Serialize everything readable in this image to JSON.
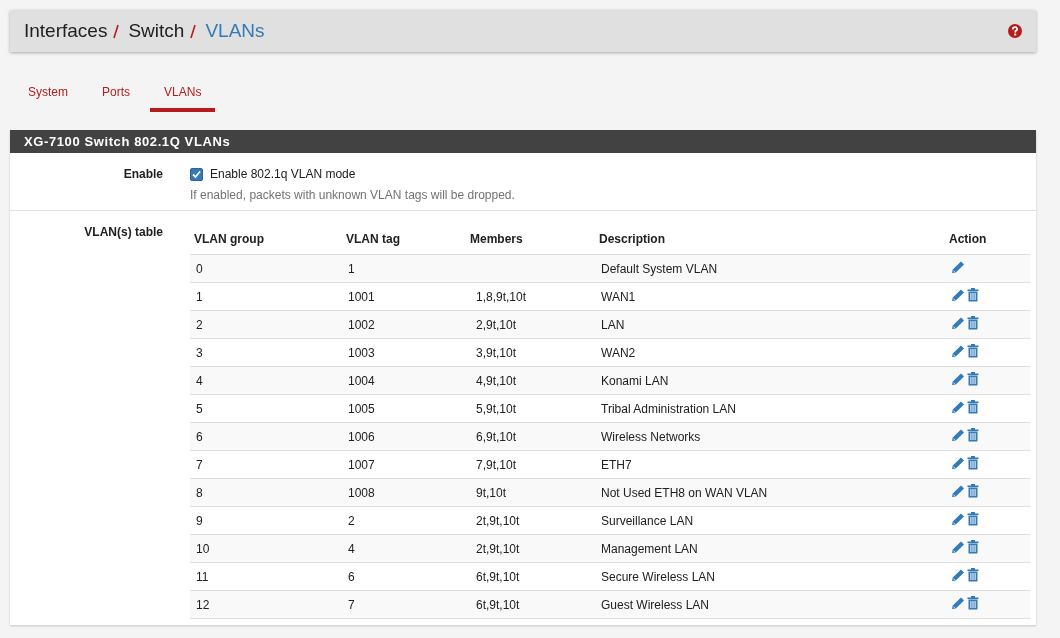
{
  "breadcrumb": [
    "Interfaces",
    "Switch",
    "VLANs"
  ],
  "tabs": [
    {
      "label": "System",
      "selected": false
    },
    {
      "label": "Ports",
      "selected": false
    },
    {
      "label": "VLANs",
      "selected": true
    }
  ],
  "panel": {
    "title": "XG-7100 Switch 802.1Q VLANs",
    "enable": {
      "label": "Enable",
      "checkbox_label": "Enable 802.1q VLAN mode",
      "checked": true,
      "help": "If enabled, packets with unknown VLAN tags will be dropped."
    },
    "table_label": "VLAN(s) table",
    "columns": [
      "VLAN group",
      "VLAN tag",
      "Members",
      "Description",
      "Action"
    ],
    "rows": [
      {
        "group": "0",
        "tag": "1",
        "members": "",
        "description": "Default System VLAN",
        "deletable": false
      },
      {
        "group": "1",
        "tag": "1001",
        "members": "1,8,9t,10t",
        "description": "WAN1",
        "deletable": true
      },
      {
        "group": "2",
        "tag": "1002",
        "members": "2,9t,10t",
        "description": "LAN",
        "deletable": true
      },
      {
        "group": "3",
        "tag": "1003",
        "members": "3,9t,10t",
        "description": "WAN2",
        "deletable": true
      },
      {
        "group": "4",
        "tag": "1004",
        "members": "4,9t,10t",
        "description": "Konami LAN",
        "deletable": true
      },
      {
        "group": "5",
        "tag": "1005",
        "members": "5,9t,10t",
        "description": "Tribal Administration LAN",
        "deletable": true
      },
      {
        "group": "6",
        "tag": "1006",
        "members": "6,9t,10t",
        "description": "Wireless Networks",
        "deletable": true
      },
      {
        "group": "7",
        "tag": "1007",
        "members": "7,9t,10t",
        "description": "ETH7",
        "deletable": true
      },
      {
        "group": "8",
        "tag": "1008",
        "members": "9t,10t",
        "description": "Not Used ETH8 on WAN VLAN",
        "deletable": true
      },
      {
        "group": "9",
        "tag": "2",
        "members": "2t,9t,10t",
        "description": "Surveillance LAN",
        "deletable": true
      },
      {
        "group": "10",
        "tag": "4",
        "members": "2t,9t,10t",
        "description": "Management LAN",
        "deletable": true
      },
      {
        "group": "11",
        "tag": "6",
        "members": "6t,9t,10t",
        "description": "Secure Wireless LAN",
        "deletable": true
      },
      {
        "group": "12",
        "tag": "7",
        "members": "6t,9t,10t",
        "description": "Guest Wireless LAN",
        "deletable": true
      }
    ]
  }
}
